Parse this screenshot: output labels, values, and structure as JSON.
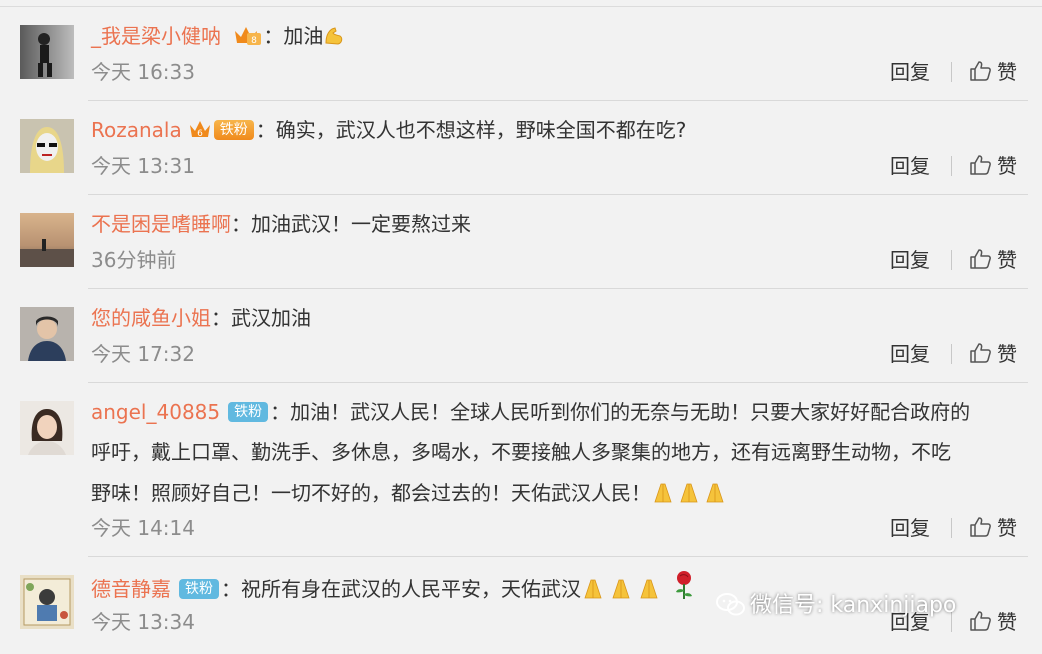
{
  "colors": {
    "username": "#eb7350",
    "badge": "#61b9e0",
    "time": "#8c8c8c"
  },
  "actions": {
    "reply": "回复",
    "like": "赞"
  },
  "comments": [
    {
      "username": "_我是梁小健呐",
      "sep": "：",
      "text": "加油",
      "emoji": "flexed-biceps",
      "time": "今天 16:33",
      "badge": ""
    },
    {
      "username": "Rozanala",
      "badge": "铁粉",
      "sep": "：",
      "text": "确实，武汉人也不想这样，野味全国不都在吃?",
      "time": "今天 13:31"
    },
    {
      "username": "不是困是嗜睡啊",
      "sep": "：",
      "text": "加油武汉！一定要熬过来",
      "time": "36分钟前",
      "badge": ""
    },
    {
      "username": "您的咸鱼小姐",
      "sep": "：",
      "text": "武汉加油",
      "time": "今天 17:32",
      "badge": ""
    },
    {
      "username": "angel_40885",
      "badge": "铁粉",
      "sep": "：",
      "text_line1": "加油！武汉人民！全球人民听到你们的无奈与无助！只要大家好好配合政府的",
      "text_line2": "呼吁，戴上口罩、勤洗手、多休息，多喝水，不要接触人多聚集的地方，还有远离野生动物，不吃",
      "text_line3": "野味！照顾好自己！一切不好的，都会过去的！天佑武汉人民！",
      "emoji": "folded-hands x3",
      "time": "今天 14:14"
    },
    {
      "username": "德音静嘉",
      "badge": "铁粉",
      "sep": "：",
      "text": "祝所有身在武汉的人民平安，天佑武汉",
      "emoji": "folded-hands x3, rose",
      "time": "今天 13:34"
    }
  ],
  "watermark": {
    "text": "微信号: kanxinjiapo"
  }
}
